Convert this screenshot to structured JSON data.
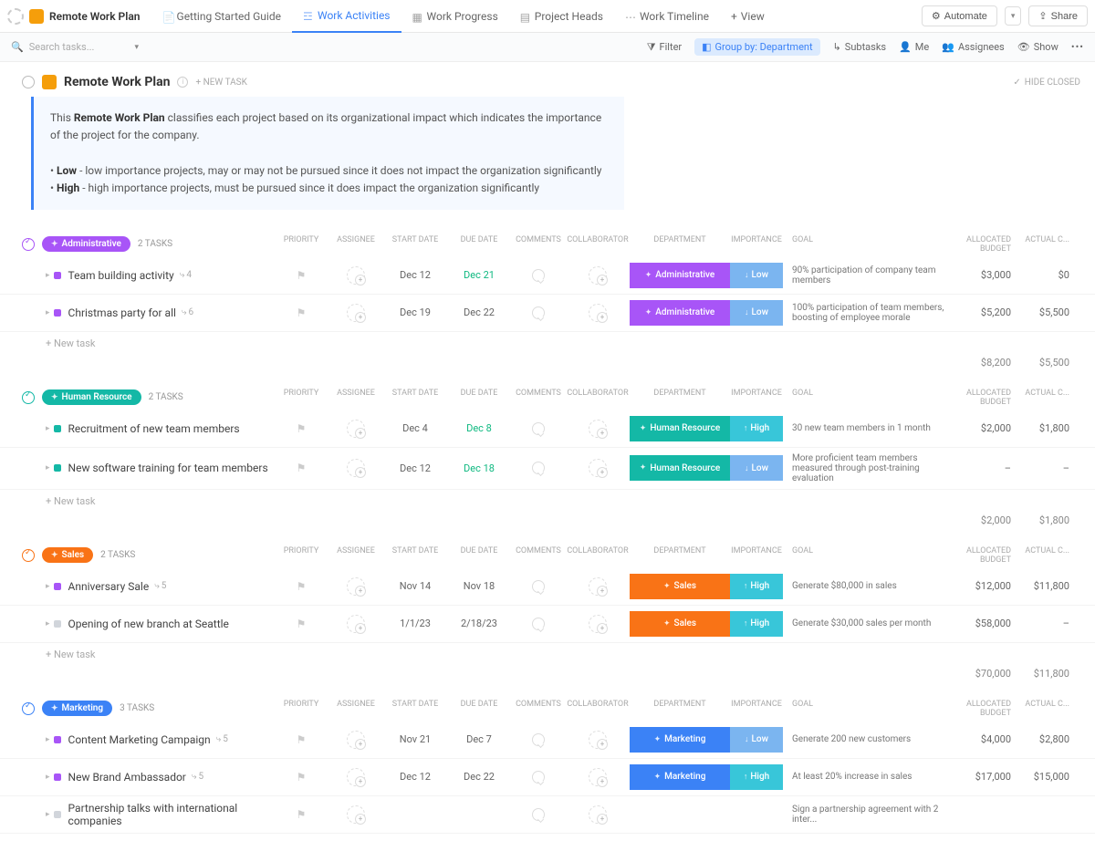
{
  "nav": {
    "title": "Remote Work Plan",
    "tabs": [
      {
        "label": "Getting Started Guide"
      },
      {
        "label": "Work Activities"
      },
      {
        "label": "Work Progress"
      },
      {
        "label": "Project Heads"
      },
      {
        "label": "Work Timeline"
      }
    ],
    "view": "View",
    "automate": "Automate",
    "share": "Share"
  },
  "toolbar": {
    "search_placeholder": "Search tasks...",
    "filter": "Filter",
    "group": "Group by: Department",
    "subtasks": "Subtasks",
    "me": "Me",
    "assignees": "Assignees",
    "show": "Show"
  },
  "header": {
    "title": "Remote Work Plan",
    "new_task": "+ NEW TASK",
    "hide_closed": "HIDE CLOSED"
  },
  "description": {
    "intro_pre": "This ",
    "intro_bold": "Remote Work Plan",
    "intro_post": " classifies each project based on its organizational impact which indicates the importance of the project for the company.",
    "low_label": "Low",
    "low_text": " - low importance projects, may or may not be pursued since it does not impact the organization significantly",
    "high_label": "High",
    "high_text": " - high importance projects, must be pursued since it does impact the organization significantly"
  },
  "columns": {
    "priority": "Priority",
    "assignee": "Assignee",
    "start": "Start Date",
    "due": "Due Date",
    "comments": "Comments",
    "collab": "Collaborator",
    "dept": "Department",
    "import": "Importance",
    "goal": "Goal",
    "budget": "Allocated Budget",
    "actual": "Actual C..."
  },
  "new_task_label": "+ New task",
  "groups": [
    {
      "name": "Administrative",
      "color": "#a855f7",
      "count": "2 TASKS",
      "dept_class": "dept-admin",
      "tasks": [
        {
          "sq": "#a855f7",
          "name": "Team building activity",
          "sub": "4",
          "start": "Dec 12",
          "due": "Dec 21",
          "due_cls": "date-green",
          "dept": "Administrative",
          "imp": "Low",
          "imp_cls": "imp-low",
          "goal": "90% participation of company team members",
          "budget": "$3,000",
          "actual": "$0"
        },
        {
          "sq": "#a855f7",
          "name": "Christmas party for all",
          "sub": "6",
          "start": "Dec 19",
          "due": "Dec 22",
          "due_cls": "",
          "dept": "Administrative",
          "imp": "Low",
          "imp_cls": "imp-low",
          "goal": "100% participation of team members, boosting of employee morale",
          "budget": "$5,200",
          "actual": "$5,500"
        }
      ],
      "totals": {
        "budget": "$8,200",
        "actual": "$5,500"
      }
    },
    {
      "name": "Human Resource",
      "color": "#14b8a6",
      "count": "2 TASKS",
      "dept_class": "dept-hr",
      "tasks": [
        {
          "sq": "#14b8a6",
          "name": "Recruitment of new team members",
          "sub": "",
          "start": "Dec 4",
          "due": "Dec 8",
          "due_cls": "date-green",
          "dept": "Human Resource",
          "imp": "High",
          "imp_cls": "imp-high",
          "goal": "30 new team members in 1 month",
          "budget": "$2,000",
          "actual": "$1,800"
        },
        {
          "sq": "#14b8a6",
          "name": "New software training for team members",
          "sub": "",
          "start": "Dec 12",
          "due": "Dec 18",
          "due_cls": "date-green",
          "dept": "Human Resource",
          "imp": "Low",
          "imp_cls": "imp-low",
          "goal": "More proficient team members measured through post-training evaluation",
          "budget": "–",
          "actual": "–"
        }
      ],
      "totals": {
        "budget": "$2,000",
        "actual": "$1,800"
      }
    },
    {
      "name": "Sales",
      "color": "#f97316",
      "count": "2 TASKS",
      "dept_class": "dept-sales",
      "tasks": [
        {
          "sq": "#a855f7",
          "name": "Anniversary Sale",
          "sub": "5",
          "start": "Nov 14",
          "due": "Nov 18",
          "due_cls": "",
          "dept": "Sales",
          "imp": "High",
          "imp_cls": "imp-high",
          "goal": "Generate $80,000 in sales",
          "budget": "$12,000",
          "actual": "$11,800"
        },
        {
          "sq": "#d1d5db",
          "name": "Opening of new branch at Seattle",
          "sub": "",
          "start": "1/1/23",
          "due": "2/18/23",
          "due_cls": "",
          "dept": "Sales",
          "imp": "High",
          "imp_cls": "imp-high",
          "goal": "Generate $30,000 sales per month",
          "budget": "$58,000",
          "actual": "–"
        }
      ],
      "totals": {
        "budget": "$70,000",
        "actual": "$11,800"
      }
    },
    {
      "name": "Marketing",
      "color": "#3b82f6",
      "count": "3 TASKS",
      "dept_class": "dept-mkt",
      "tasks": [
        {
          "sq": "#a855f7",
          "name": "Content Marketing Campaign",
          "sub": "5",
          "start": "Nov 21",
          "due": "Dec 7",
          "due_cls": "",
          "dept": "Marketing",
          "imp": "Low",
          "imp_cls": "imp-low",
          "goal": "Generate 200 new customers",
          "budget": "$4,000",
          "actual": "$2,800"
        },
        {
          "sq": "#a855f7",
          "name": "New Brand Ambassador",
          "sub": "5",
          "start": "Dec 12",
          "due": "Dec 22",
          "due_cls": "",
          "dept": "Marketing",
          "imp": "High",
          "imp_cls": "imp-high",
          "goal": "At least 20% increase in sales",
          "budget": "$17,000",
          "actual": "$15,000"
        },
        {
          "sq": "#d1d5db",
          "name": "Partnership talks with international companies",
          "sub": "",
          "start": "",
          "due": "",
          "due_cls": "",
          "dept": "",
          "imp": "",
          "imp_cls": "",
          "goal": "Sign a partnership agreement with 2 inter...",
          "budget": "",
          "actual": ""
        }
      ],
      "totals": null
    }
  ]
}
